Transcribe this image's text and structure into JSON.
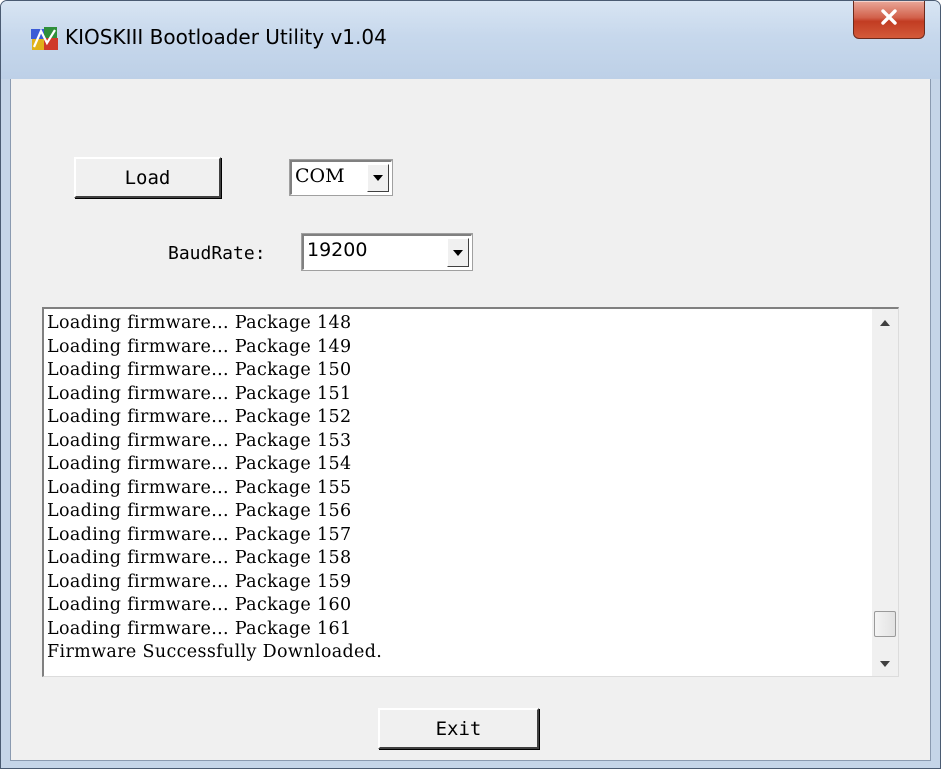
{
  "window": {
    "title": "KIOSKIII Bootloader Utility v1.04"
  },
  "controls": {
    "load_label": "Load",
    "port_value": "COM",
    "baud_label": "BaudRate:",
    "baud_value": "19200",
    "exit_label": "Exit"
  },
  "log": {
    "lines": [
      "Loading firmware... Package 148",
      "Loading firmware... Package 149",
      "Loading firmware... Package 150",
      "Loading firmware... Package 151",
      "Loading firmware... Package 152",
      "Loading firmware... Package 153",
      "Loading firmware... Package 154",
      "Loading firmware... Package 155",
      "Loading firmware... Package 156",
      "Loading firmware... Package 157",
      "Loading firmware... Package 158",
      "Loading firmware... Package 159",
      "Loading firmware... Package 160",
      "Loading firmware... Package 161",
      "Firmware Successfully Downloaded."
    ]
  },
  "icons": {
    "app": "app-icon",
    "close": "close-icon",
    "dropdown": "chevron-down-icon",
    "scroll_up": "scroll-up-arrow-icon",
    "scroll_down": "scroll-down-arrow-icon"
  },
  "colors": {
    "close_button": "#c23c22",
    "titlebar": "#c7d8ec",
    "client_background": "#f0f0f0"
  }
}
